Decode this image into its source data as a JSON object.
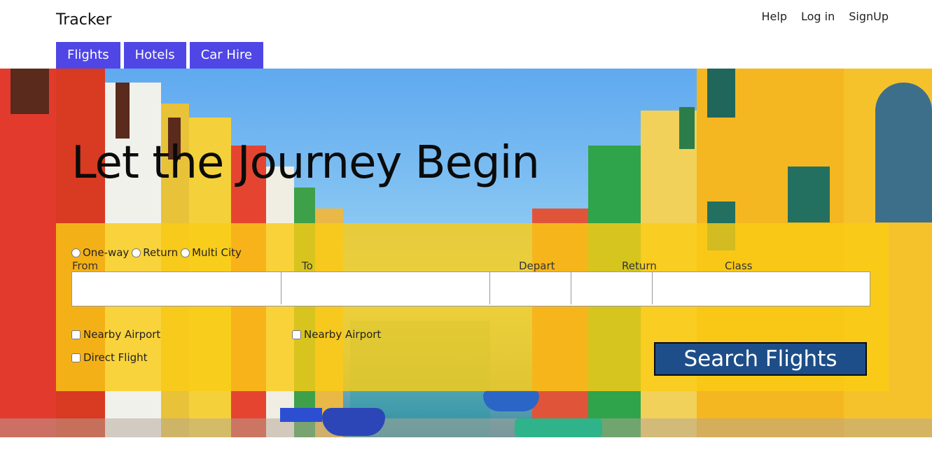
{
  "header": {
    "brand": "Tracker",
    "links": [
      "Help",
      "Log in",
      "SignUp"
    ]
  },
  "tabs": [
    "Flights",
    "Hotels",
    "Car Hire"
  ],
  "hero": {
    "title": "Let the Journey Begin"
  },
  "search": {
    "trip_types": [
      "One-way",
      "Return",
      "Multi City"
    ],
    "fields": {
      "from": {
        "label": "From",
        "value": ""
      },
      "to": {
        "label": "To",
        "value": ""
      },
      "depart": {
        "label": "Depart",
        "value": ""
      },
      "return": {
        "label": "Return",
        "value": ""
      },
      "class": {
        "label": "Class",
        "value": ""
      }
    },
    "nearby_from": "Nearby Airport",
    "nearby_to": "Nearby Airport",
    "direct": "Direct Flight",
    "button": "Search Flights"
  },
  "colors": {
    "tab_bg": "#4f46e5",
    "panel_bg": "#facc15",
    "button_bg": "#1d4e89"
  }
}
